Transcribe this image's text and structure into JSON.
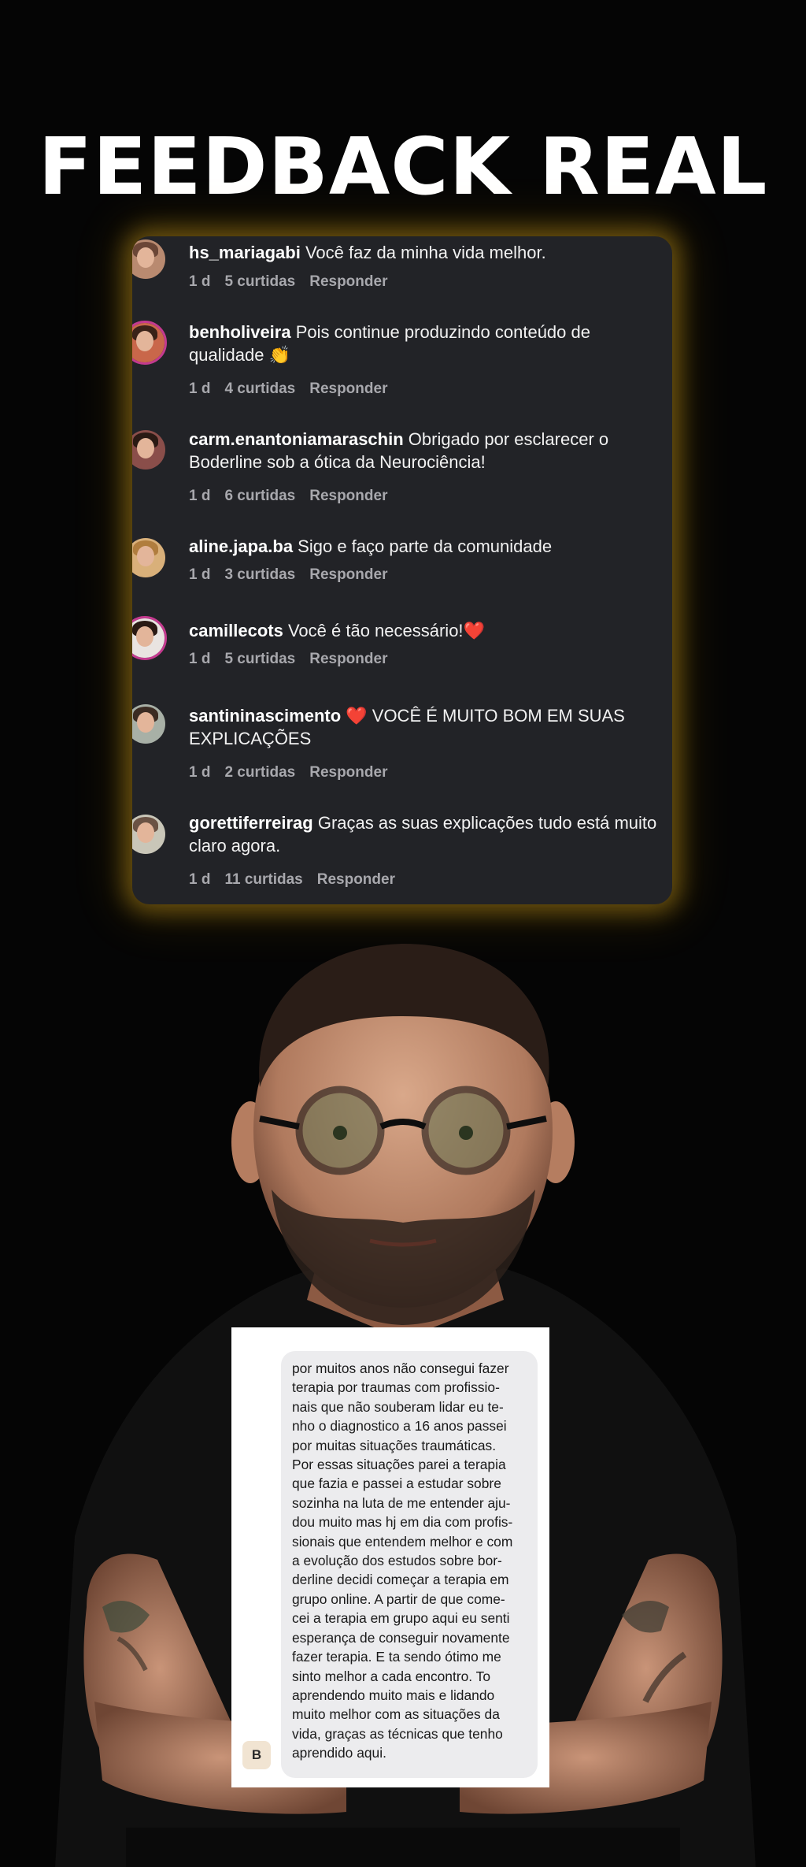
{
  "headline": "FEEDBACK REAL",
  "comments": [
    {
      "user": "hs_mariagabi",
      "text": " Você faz da minha vida melhor.",
      "text2": "",
      "time": "1 d",
      "likes": "5 curtidas",
      "reply": "Responder"
    },
    {
      "user": "benholiveira",
      "text": " Pois continue produzindo conteúdo de",
      "text2": "qualidade 👏",
      "time": "1 d",
      "likes": "4 curtidas",
      "reply": "Responder"
    },
    {
      "user": "carm.enantoniamaraschin",
      "text": " Obrigado por esclarecer o",
      "text2": "Boderline sob a ótica da Neurociência!",
      "time": "1 d",
      "likes": "6 curtidas",
      "reply": "Responder"
    },
    {
      "user": "aline.japa.ba",
      "text": " Sigo e faço parte da comunidade",
      "text2": "",
      "time": "1 d",
      "likes": "3 curtidas",
      "reply": "Responder"
    },
    {
      "user": "camillecots",
      "text": " Você é tão necessário!❤️",
      "text2": "",
      "time": "1 d",
      "likes": "5 curtidas",
      "reply": "Responder"
    },
    {
      "user": "santininascimento",
      "text": " ❤️ VOCÊ É MUITO BOM EM SUAS",
      "text2": "EXPLICAÇÕES",
      "time": "1 d",
      "likes": "2 curtidas",
      "reply": "Responder"
    },
    {
      "user": "gorettiferreirag",
      "text": " Graças as suas explicações tudo está muito",
      "text2": "claro agora.",
      "time": "1 d",
      "likes": "11 curtidas",
      "reply": "Responder"
    }
  ],
  "chat": {
    "message": "por muitos anos não consegui fazer\nterapia por traumas com profissio-\nnais que não souberam lidar eu te-\nnho o diagnostico a 16 anos passei\npor muitas situações traumáticas.\nPor essas situações parei a terapia\nque fazia e passei a estudar sobre\nsozinha na luta de me entender aju-\ndou muito mas hj em dia com profis-\nsionais que entendem melhor e com\na evolução dos estudos sobre bor-\nderline decidi começar a terapia em\ngrupo online. A partir de que come-\ncei a terapia em grupo aqui eu senti\nesperança de conseguir novamente\nfazer terapia. E ta sendo ótimo me\nsinto melhor a cada encontro. To\naprendendo muito mais e lidando\nmuito melhor com as situações da\nvida, graças as técnicas que tenho\naprendido aqui.",
    "avatar_letter": "B"
  },
  "colors": {
    "card": "#222327",
    "glow": "#ffc423",
    "ring": "#c43a8f"
  }
}
